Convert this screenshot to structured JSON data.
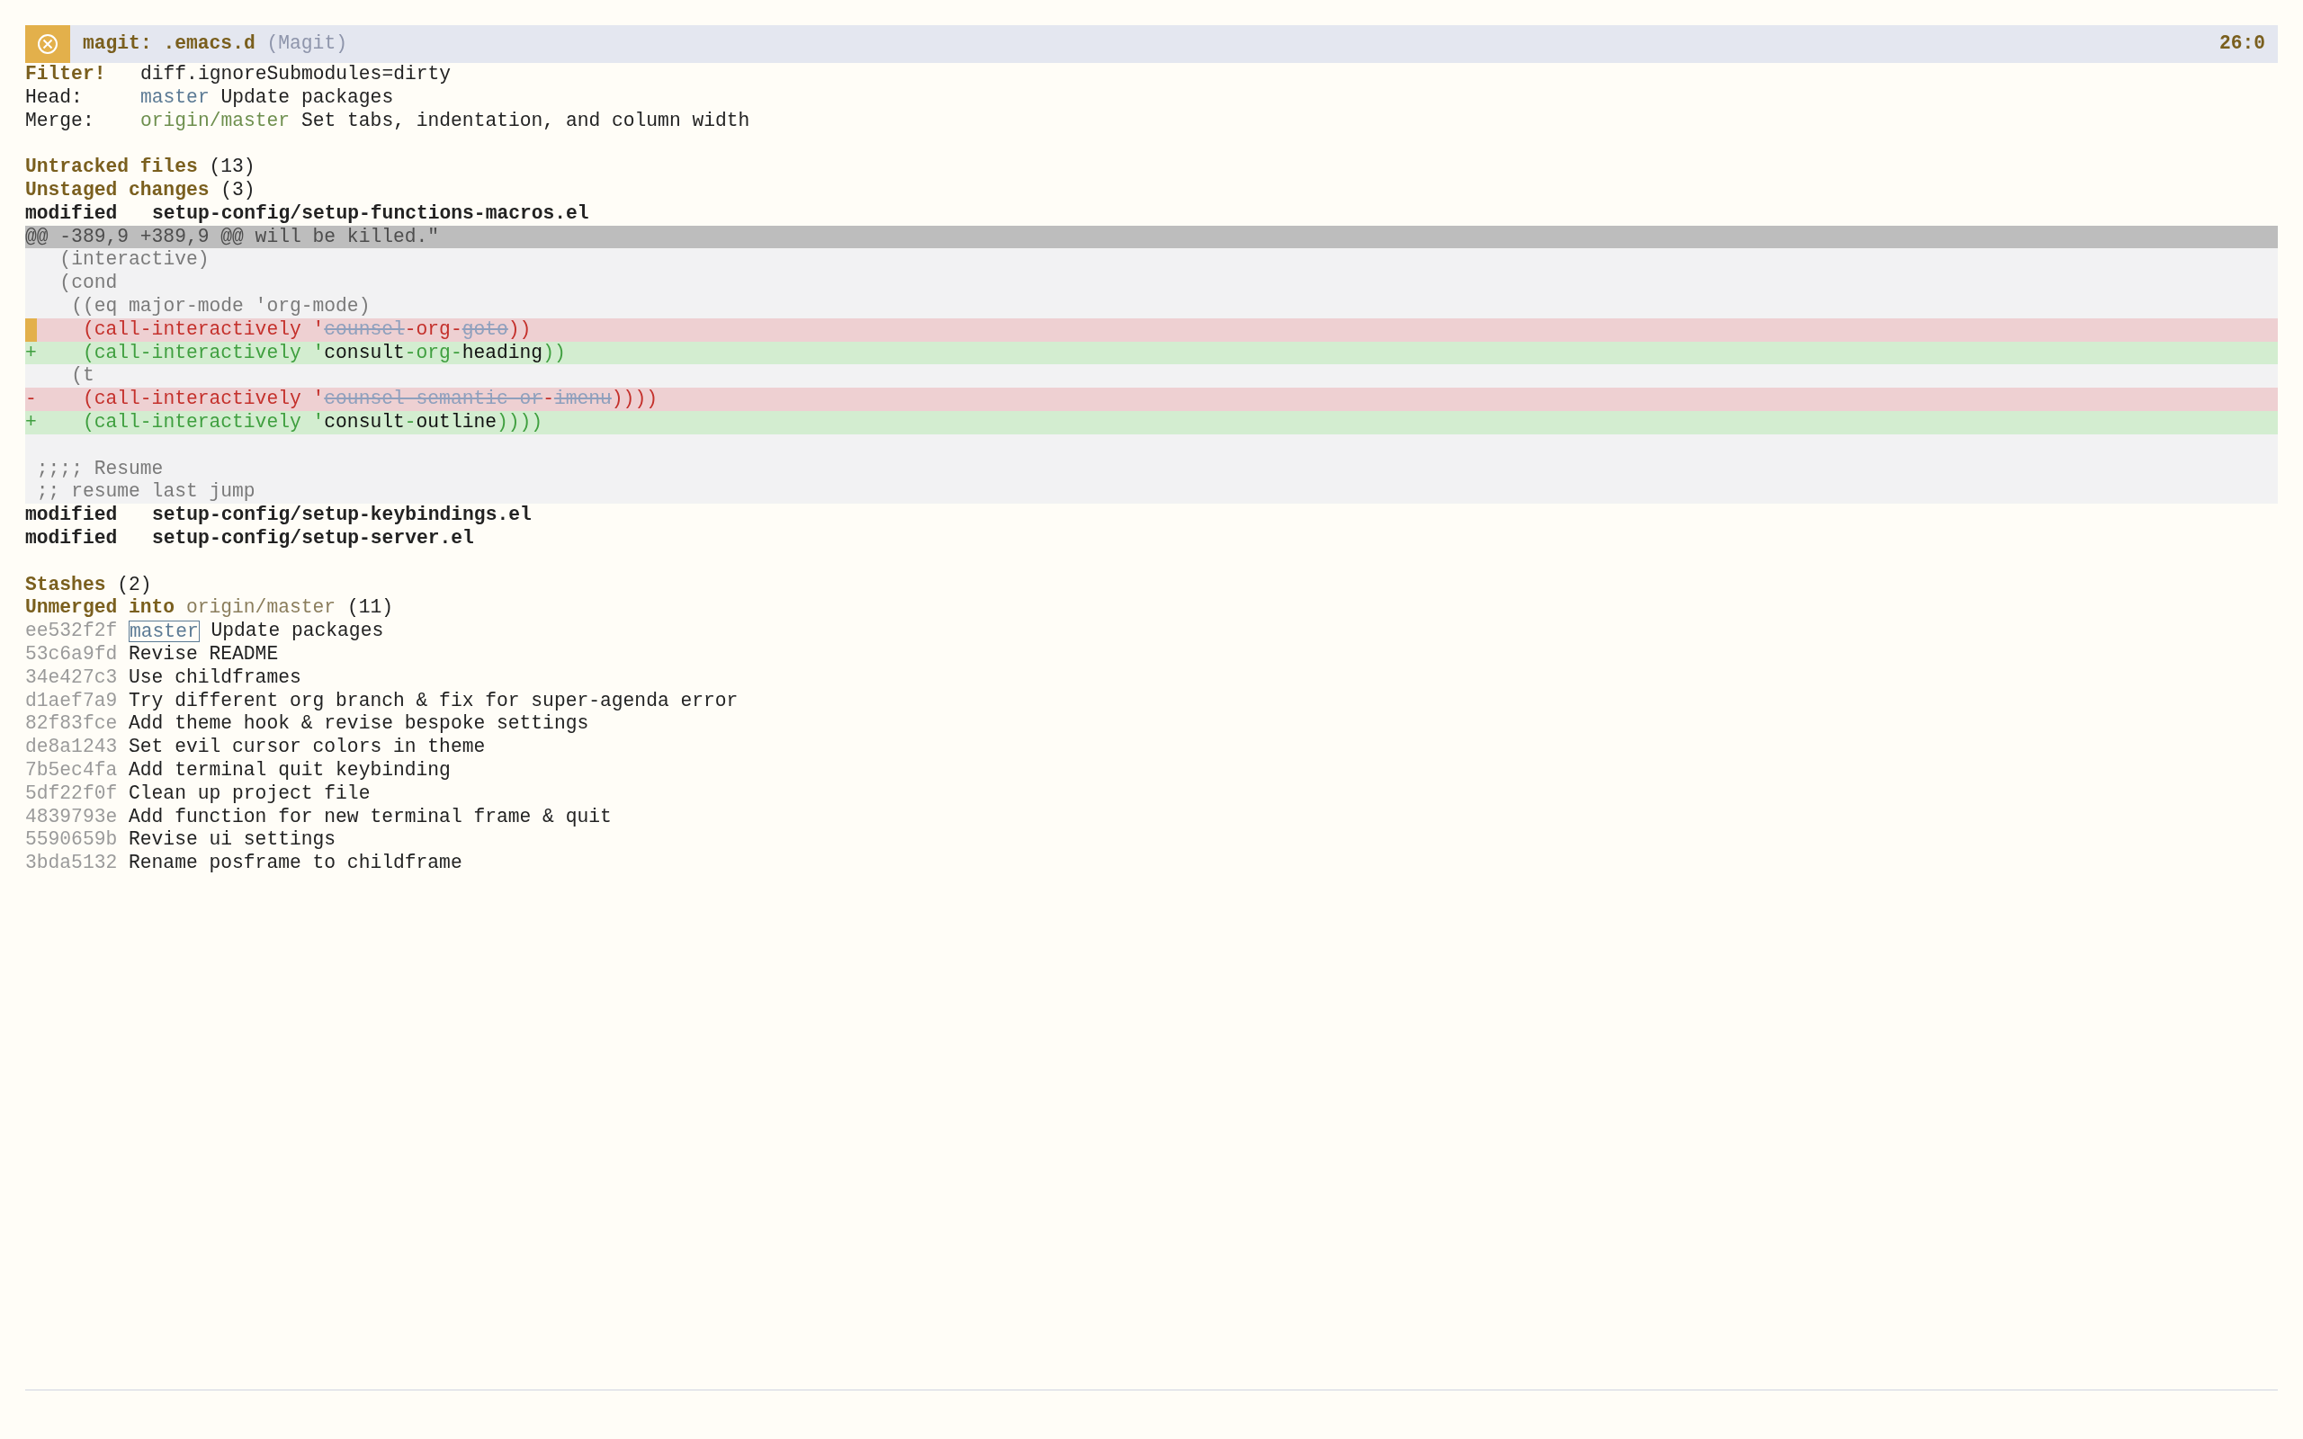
{
  "mode_line": {
    "buffer": "magit: .emacs.d",
    "mode": "(Magit)",
    "position": "26:0"
  },
  "header": [
    {
      "kind": "filter",
      "label": "Filter!",
      "value": "diff.ignoreSubmodules=dirty"
    },
    {
      "kind": "head",
      "label": "Head:",
      "branch": "master",
      "value": "Update packages"
    },
    {
      "kind": "merge",
      "label": "Merge:",
      "branch": "origin/master",
      "value": "Set tabs, indentation, and column width"
    }
  ],
  "untracked": {
    "title": "Untracked files",
    "count": "(13)"
  },
  "unstaged": {
    "title": "Unstaged changes",
    "count": "(3)",
    "files": [
      {
        "status": "modified",
        "path": "setup-config/setup-functions-macros.el",
        "diff": [
          {
            "kind": "hunk",
            "segments": [
              {
                "kind": "base",
                "text": "@@ -389,9 +389,9 @@ will be killed.\""
              }
            ]
          },
          {
            "kind": "context",
            "segments": [
              {
                "kind": "base",
                "text": "  (interactive)"
              }
            ]
          },
          {
            "kind": "context",
            "segments": [
              {
                "kind": "base",
                "text": "  (cond"
              }
            ]
          },
          {
            "kind": "context",
            "segments": [
              {
                "kind": "base",
                "text": "   ((eq major-mode 'org-mode)"
              }
            ]
          },
          {
            "kind": "removed",
            "cursor": true,
            "segments": [
              {
                "kind": "base",
                "text": "    (call-interactively '"
              },
              {
                "kind": "changed",
                "text": "counsel"
              },
              {
                "kind": "base",
                "text": "-org-"
              },
              {
                "kind": "changed",
                "text": "goto"
              },
              {
                "kind": "base",
                "text": "))"
              }
            ]
          },
          {
            "kind": "added",
            "prefix": "+",
            "cursor": false,
            "segments": [
              {
                "kind": "base",
                "text": "    (call-interactively '"
              },
              {
                "kind": "changed",
                "text": "consult"
              },
              {
                "kind": "base",
                "text": "-org-"
              },
              {
                "kind": "changed",
                "text": "heading"
              },
              {
                "kind": "base",
                "text": "))"
              }
            ]
          },
          {
            "kind": "context",
            "segments": [
              {
                "kind": "base",
                "text": "   (t"
              }
            ]
          },
          {
            "kind": "removed",
            "prefix": "-",
            "cursor": false,
            "segments": [
              {
                "kind": "base",
                "text": "    (call-interactively '"
              },
              {
                "kind": "changed",
                "text": "counsel-semantic-or"
              },
              {
                "kind": "base",
                "text": "-"
              },
              {
                "kind": "changed",
                "text": "imenu"
              },
              {
                "kind": "base",
                "text": "))))"
              }
            ]
          },
          {
            "kind": "added",
            "prefix": "+",
            "cursor": false,
            "segments": [
              {
                "kind": "base",
                "text": "    (call-interactively '"
              },
              {
                "kind": "changed",
                "text": "consult"
              },
              {
                "kind": "base",
                "text": "-"
              },
              {
                "kind": "changed",
                "text": "outline"
              },
              {
                "kind": "base",
                "text": "))))"
              }
            ]
          },
          {
            "kind": "context"
          },
          {
            "kind": "context",
            "segments": [
              {
                "kind": "base",
                "text": ";;;; Resume"
              }
            ]
          },
          {
            "kind": "context",
            "segments": [
              {
                "kind": "base",
                "text": ";; resume last jump"
              }
            ]
          }
        ]
      },
      {
        "status": "modified",
        "path": "setup-config/setup-keybindings.el"
      },
      {
        "status": "modified",
        "path": "setup-config/setup-server.el"
      }
    ]
  },
  "stashes": {
    "title": "Stashes",
    "count": "(2)"
  },
  "unmerged": {
    "title": "Unmerged into",
    "branch": "origin/master",
    "count": "(11)",
    "commits": [
      {
        "hash": "ee532f2f",
        "ref": "master",
        "message": "Update packages"
      },
      {
        "hash": "53c6a9fd",
        "message": "Revise README"
      },
      {
        "hash": "34e427c3",
        "message": "Use childframes"
      },
      {
        "hash": "d1aef7a9",
        "message": "Try different org branch & fix for super-agenda error"
      },
      {
        "hash": "82f83fce",
        "message": "Add theme hook & revise bespoke settings"
      },
      {
        "hash": "de8a1243",
        "message": "Set evil cursor colors in theme"
      },
      {
        "hash": "7b5ec4fa",
        "message": "Add terminal quit keybinding"
      },
      {
        "hash": "5df22f0f",
        "message": "Clean up project file"
      },
      {
        "hash": "4839793e",
        "message": "Add function for new terminal frame & quit"
      },
      {
        "hash": "5590659b",
        "message": "Revise ui settings"
      },
      {
        "hash": "3bda5132",
        "message": "Rename posframe to childframe"
      }
    ]
  }
}
